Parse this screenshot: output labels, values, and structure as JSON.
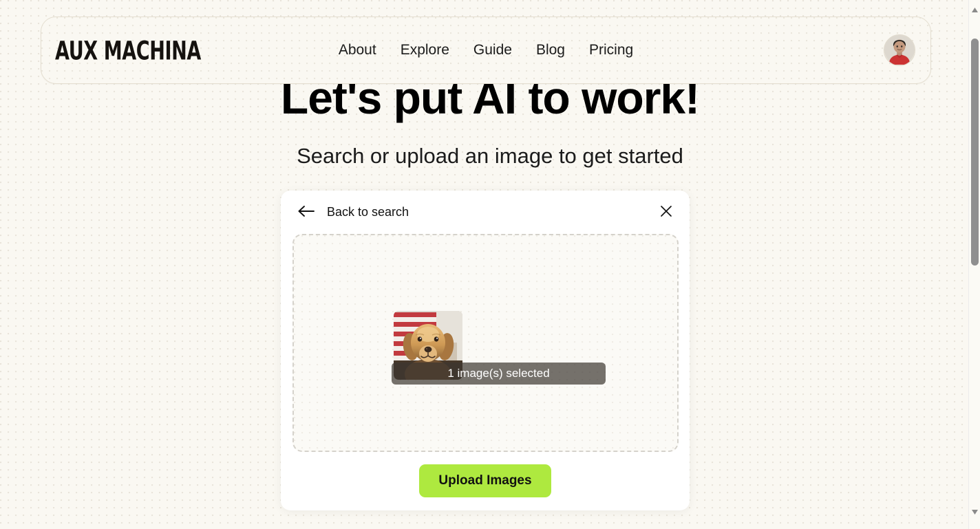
{
  "header": {
    "logo_text": "AUX MACHINA",
    "nav": [
      {
        "label": "About"
      },
      {
        "label": "Explore"
      },
      {
        "label": "Guide"
      },
      {
        "label": "Blog"
      },
      {
        "label": "Pricing"
      }
    ],
    "avatar_alt": "user-avatar"
  },
  "hero": {
    "title": "Let's put AI to work!",
    "subtitle": "Search or upload an image to get started"
  },
  "modal": {
    "back_label": "Back to search",
    "close_label": "×",
    "dropzone": {
      "selected_text": "1 image(s) selected",
      "thumbnail_alt": "golden-retriever-photo"
    },
    "upload_button": "Upload Images"
  },
  "colors": {
    "page_background": "#faf8f2",
    "accent_button": "#aee93f",
    "modal_background": "#ffffff",
    "dropzone_border": "#d5d2cb",
    "overlay_bar": "rgba(60,54,48,0.70)",
    "text_primary": "#111111"
  },
  "scrollbar": {
    "up_arrow": "▲",
    "down_arrow": "▼"
  }
}
